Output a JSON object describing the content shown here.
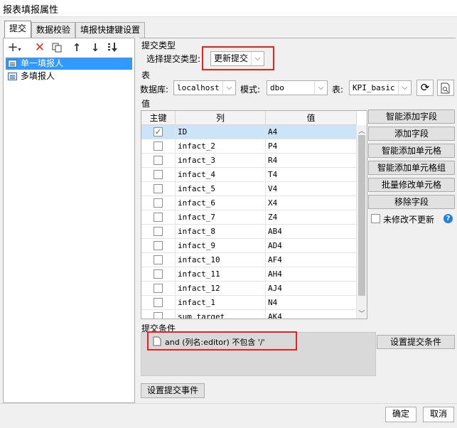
{
  "window": {
    "title": "报表填报属性"
  },
  "tabs": [
    {
      "label": "提交"
    },
    {
      "label": "数据校验"
    },
    {
      "label": "填报快捷键设置"
    }
  ],
  "left_toolbar": {
    "icons": [
      "add-dropdown-icon",
      "delete-icon",
      "copy-icon",
      "move-up-icon",
      "move-down-icon",
      "sort-icon"
    ]
  },
  "tree": {
    "items": [
      {
        "label": "单一填报人",
        "selected": true
      },
      {
        "label": "多填报人",
        "selected": false
      }
    ]
  },
  "submit_type": {
    "section_title": "提交类型",
    "select_label": "选择提交类型:",
    "select_value": "更新提交"
  },
  "table_section": {
    "section_title": "表",
    "db_label": "数据库:",
    "db_value": "localhost",
    "schema_label": "模式:",
    "schema_value": "dbo",
    "table_label": "表:",
    "table_value": "KPI_basic"
  },
  "values_section": {
    "section_title": "值",
    "columns": [
      "主键",
      "列",
      "值"
    ],
    "rows": [
      {
        "key": true,
        "column": "ID",
        "value": "A4"
      },
      {
        "key": false,
        "column": "infact_2",
        "value": "P4"
      },
      {
        "key": false,
        "column": "infact_3",
        "value": "R4"
      },
      {
        "key": false,
        "column": "infact_4",
        "value": "T4"
      },
      {
        "key": false,
        "column": "infact_5",
        "value": "V4"
      },
      {
        "key": false,
        "column": "infact_6",
        "value": "X4"
      },
      {
        "key": false,
        "column": "infact_7",
        "value": "Z4"
      },
      {
        "key": false,
        "column": "infact_8",
        "value": "AB4"
      },
      {
        "key": false,
        "column": "infact_9",
        "value": "AD4"
      },
      {
        "key": false,
        "column": "infact_10",
        "value": "AF4"
      },
      {
        "key": false,
        "column": "infact_11",
        "value": "AH4"
      },
      {
        "key": false,
        "column": "infact_12",
        "value": "AJ4"
      },
      {
        "key": false,
        "column": "infact_1",
        "value": "N4"
      },
      {
        "key": false,
        "column": "sum_target",
        "value": "AK4"
      }
    ],
    "side_buttons": {
      "smart_add_field": "智能添加字段",
      "add_field": "添加字段",
      "smart_add_cell": "智能添加单元格",
      "smart_add_cell_group": "智能添加单元格组",
      "batch_edit_cell": "批量修改单元格",
      "remove_field": "移除字段"
    },
    "no_update_label": "未修改不更新",
    "no_update_checked": false
  },
  "condition_section": {
    "section_title": "提交条件",
    "condition_text": "and (列名:editor) 不包含 '/'",
    "set_condition_button": "设置提交条件"
  },
  "event_button": "设置提交事件",
  "footer": {
    "ok": "确定",
    "cancel": "取消"
  },
  "colors": {
    "selection": "#3399ff",
    "row_selected": "#cce4f7",
    "highlight_box": "#e8231e"
  }
}
